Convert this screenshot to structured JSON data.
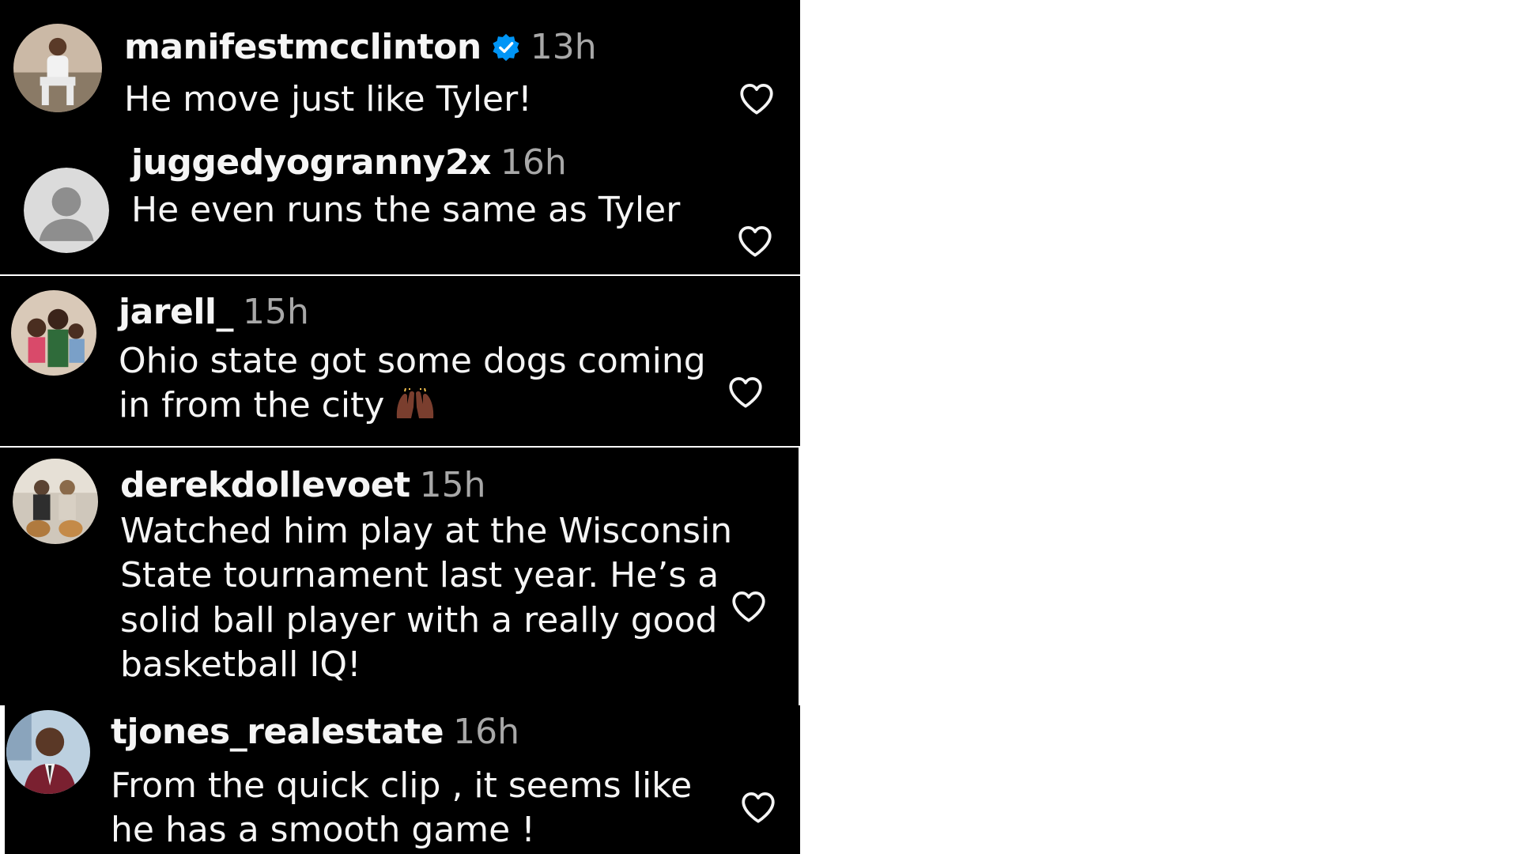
{
  "comments": [
    {
      "username": "manifestmcclinton",
      "verified": true,
      "time": "13h",
      "text": "He move just like Tyler!",
      "avatar_icon": "profile-photo"
    },
    {
      "username": "juggedyogranny2x",
      "time": "16h",
      "text": "He even runs the same as Tyler",
      "avatar_icon": "default-avatar-icon"
    },
    {
      "username": "jarell_",
      "time": "15h",
      "text_lines": [
        "Ohio state got some dogs coming",
        "in from the city"
      ],
      "emoji": "raised-hands",
      "avatar_icon": "profile-photo"
    },
    {
      "username": "derekdollevoet",
      "time": "15h",
      "text_lines": [
        "Watched him play at the Wisconsin",
        "State tournament last year. He’s a",
        "solid ball player with a really good",
        "basketball IQ!"
      ],
      "avatar_icon": "profile-photo"
    },
    {
      "username": "tjones_realestate",
      "time": "16h",
      "text_lines": [
        "From the quick clip , it seems like",
        "he has a smooth game !"
      ],
      "avatar_icon": "profile-photo"
    }
  ],
  "colors": {
    "background": "#000000",
    "text": "#f5f5f5",
    "muted": "#a8a8a8",
    "verified_blue": "#0095f6"
  },
  "icons": {
    "like": "heart-outline-icon",
    "verified": "verified-badge-icon"
  }
}
